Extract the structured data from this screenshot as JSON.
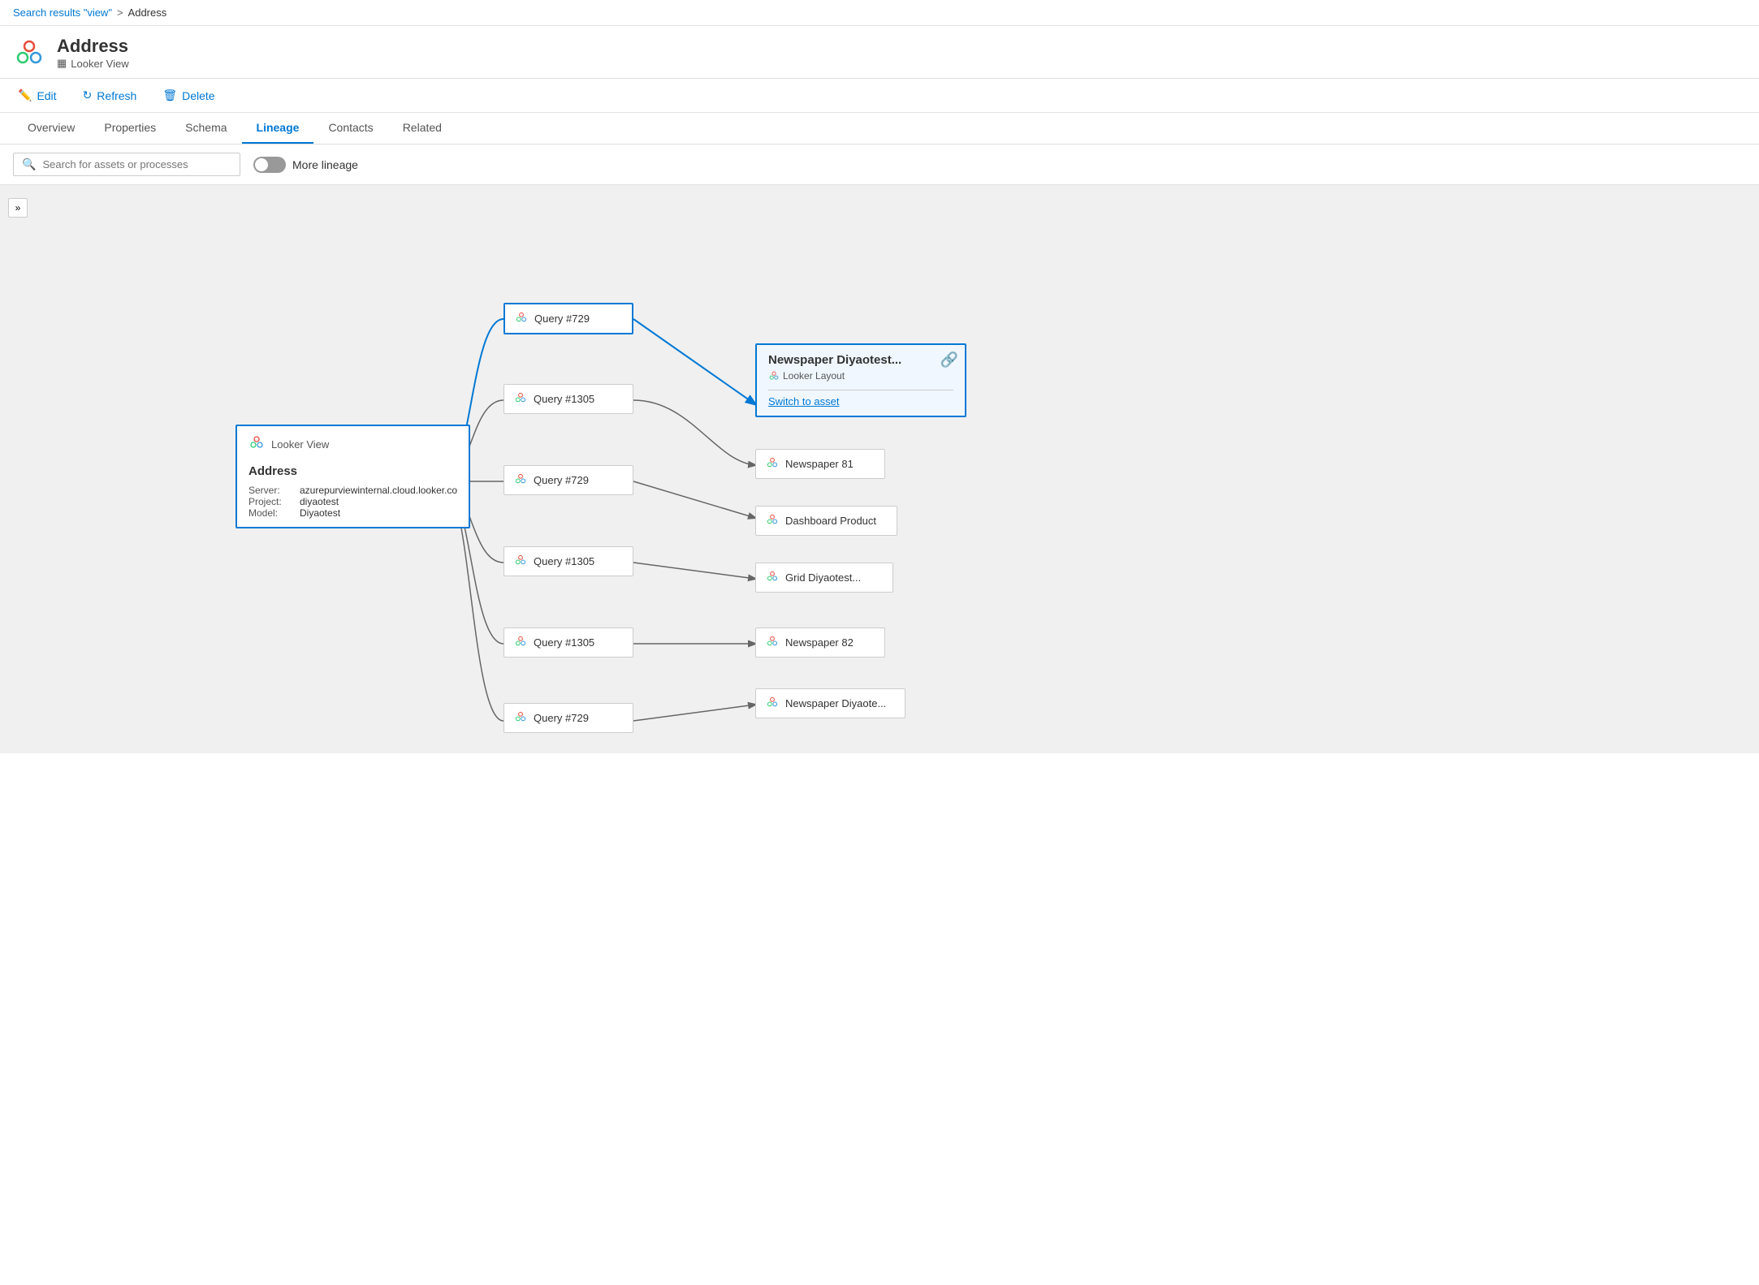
{
  "breadcrumb": {
    "link_text": "Search results \"view\"",
    "separator": ">",
    "current": "Address"
  },
  "header": {
    "title": "Address",
    "subtitle": "Looker View",
    "subtitle_icon": "table-icon"
  },
  "toolbar": {
    "edit_label": "Edit",
    "refresh_label": "Refresh",
    "delete_label": "Delete"
  },
  "tabs": [
    {
      "label": "Overview",
      "active": false
    },
    {
      "label": "Properties",
      "active": false
    },
    {
      "label": "Schema",
      "active": false
    },
    {
      "label": "Lineage",
      "active": true
    },
    {
      "label": "Contacts",
      "active": false
    },
    {
      "label": "Related",
      "active": false
    }
  ],
  "lineage_toolbar": {
    "search_placeholder": "Search for assets or processes",
    "more_lineage": "More lineage"
  },
  "canvas": {
    "collapse_btn": "»",
    "source_node": {
      "type_label": "Looker View",
      "title": "Address",
      "server_label": "Server:",
      "server_value": "azurepurviewinternal.cloud.looker.co",
      "project_label": "Project:",
      "project_value": "diyaotest",
      "model_label": "Model:",
      "model_value": "Diyaotest"
    },
    "popup_node": {
      "title": "Newspaper Diyaotest...",
      "subtitle": "Looker Layout",
      "link_text": "Switch to asset"
    },
    "query_nodes": [
      {
        "id": "q1",
        "label": "Query #729"
      },
      {
        "id": "q2",
        "label": "Query #1305"
      },
      {
        "id": "q3",
        "label": "Query #729"
      },
      {
        "id": "q4",
        "label": "Query #1305"
      },
      {
        "id": "q5",
        "label": "Query #1305"
      },
      {
        "id": "q6",
        "label": "Query #729"
      }
    ],
    "result_nodes": [
      {
        "id": "r1",
        "label": "Newspaper 81"
      },
      {
        "id": "r2",
        "label": "Dashboard Product"
      },
      {
        "id": "r3",
        "label": "Grid Diyaotest..."
      },
      {
        "id": "r4",
        "label": "Newspaper 82"
      },
      {
        "id": "r5",
        "label": "Newspaper Diyaote..."
      }
    ]
  }
}
